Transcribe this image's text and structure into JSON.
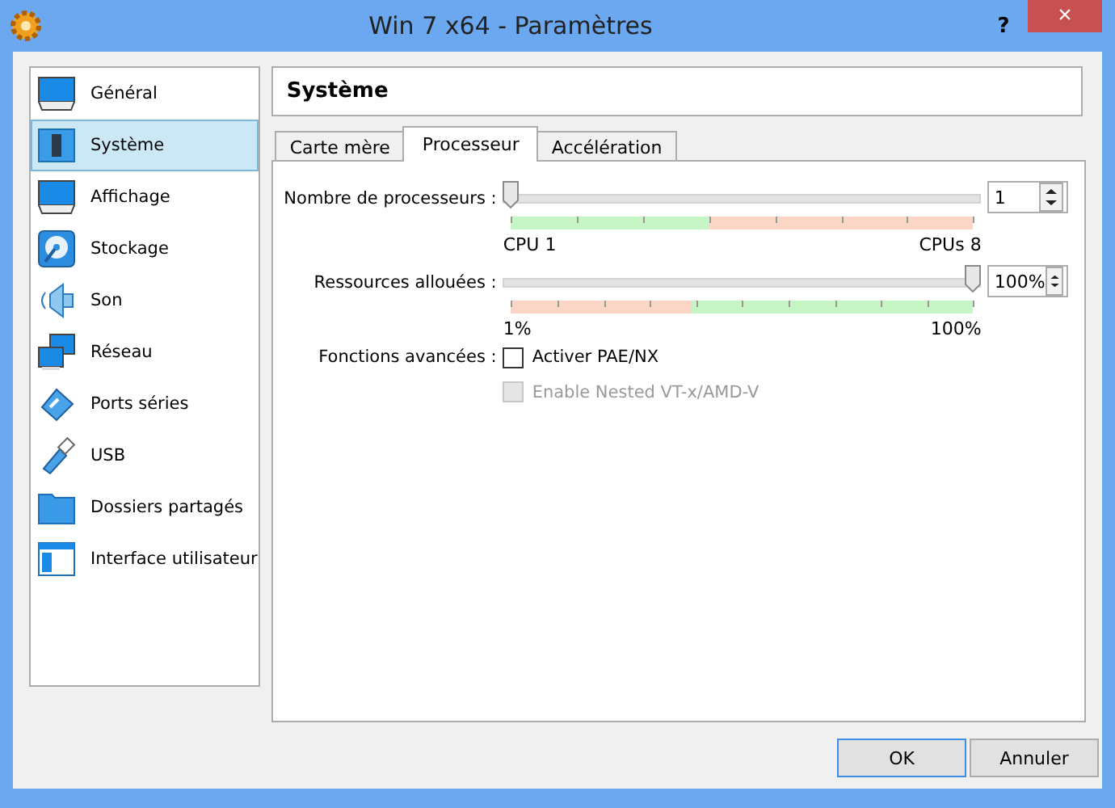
{
  "window": {
    "title": "Win 7 x64 - Paramètres",
    "help": "?",
    "close": "×"
  },
  "sidebar": {
    "items": [
      {
        "label": "Général",
        "selected": false
      },
      {
        "label": "Système",
        "selected": true
      },
      {
        "label": "Affichage",
        "selected": false
      },
      {
        "label": "Stockage",
        "selected": false
      },
      {
        "label": "Son",
        "selected": false
      },
      {
        "label": "Réseau",
        "selected": false
      },
      {
        "label": "Ports séries",
        "selected": false
      },
      {
        "label": "USB",
        "selected": false
      },
      {
        "label": "Dossiers partagés",
        "selected": false
      },
      {
        "label": "Interface utilisateur",
        "selected": false
      }
    ]
  },
  "header": "Système",
  "tabs": [
    {
      "label": "Carte mère",
      "selected": false
    },
    {
      "label": "Processeur",
      "selected": true
    },
    {
      "label": "Accélération",
      "selected": false
    }
  ],
  "sliders": [
    {
      "kind": "count",
      "label": "Nombre de processeurs :",
      "level": 0,
      "value": "1",
      "min_label": "CPU 1",
      "max_label": "CPUs 8"
    },
    {
      "kind": "percent",
      "label": "Ressources allouées :",
      "level": 1,
      "value": "100%",
      "min_label": "1%",
      "max_label": "100%"
    }
  ],
  "features": {
    "label": "Fonctions avancées :",
    "options": [
      {
        "label": "Activer PAE/NX",
        "checked": false,
        "disabled": false
      },
      {
        "label": "Enable Nested VT-x/AMD-V",
        "checked": false,
        "disabled": true
      }
    ]
  },
  "buttons": [
    {
      "label": "OK",
      "default": true
    },
    {
      "label": "Annuler",
      "default": false
    }
  ]
}
